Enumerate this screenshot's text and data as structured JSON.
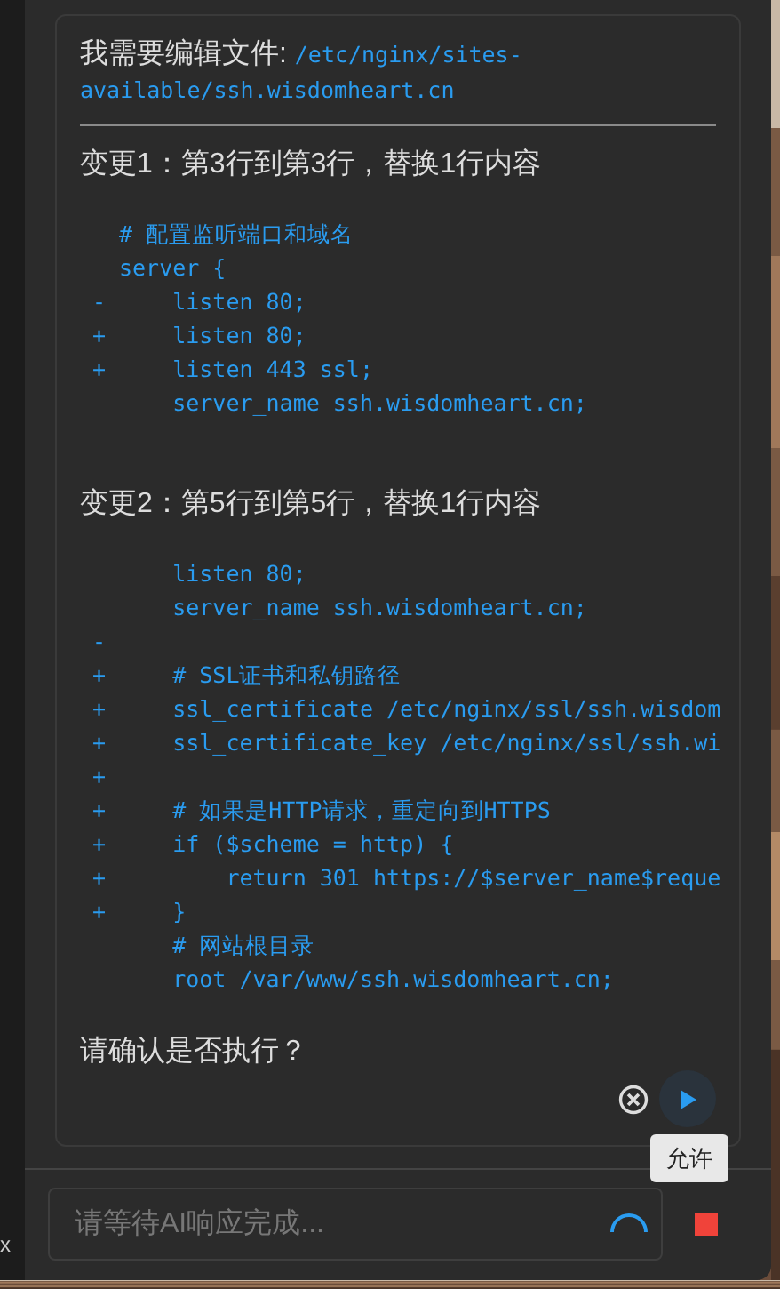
{
  "message": {
    "intro": "我需要编辑文件:",
    "path": "/etc/nginx/sites-available/ssh.wisdomheart.cn",
    "changes": [
      {
        "title": "变更1：第3行到第3行，替换1行内容",
        "lines": [
          {
            "text": "# 配置监听端口和域名"
          },
          {
            "text": "server {"
          },
          {
            "marker": "-",
            "text": "    listen 80;"
          },
          {
            "marker": "+",
            "text": "    listen 80;"
          },
          {
            "marker": "+",
            "text": "    listen 443 ssl;"
          },
          {
            "text": "    server_name ssh.wisdomheart.cn;"
          }
        ]
      },
      {
        "title": "变更2：第5行到第5行，替换1行内容",
        "lines": [
          {
            "text": "    listen 80;"
          },
          {
            "text": "    server_name ssh.wisdomheart.cn;"
          },
          {
            "marker": "-"
          },
          {
            "marker": "+",
            "text": "    # SSL证书和私钥路径"
          },
          {
            "marker": "+",
            "text": "    ssl_certificate /etc/nginx/ssl/ssh.wisdom"
          },
          {
            "marker": "+",
            "text": "    ssl_certificate_key /etc/nginx/ssl/ssh.wi"
          },
          {
            "marker": "+"
          },
          {
            "marker": "+",
            "text": "    # 如果是HTTP请求，重定向到HTTPS"
          },
          {
            "marker": "+",
            "text": "    if ($scheme = http) {"
          },
          {
            "marker": "+",
            "text": "        return 301 https://$server_name$reque"
          },
          {
            "marker": "+",
            "text": "    }"
          },
          {
            "text": "    # 网站根目录"
          },
          {
            "text": "    root /var/www/ssh.wisdomheart.cn;"
          }
        ]
      }
    ],
    "question": "请确认是否执行？"
  },
  "tooltip": "允许",
  "input": {
    "placeholder": "请等待AI响应完成..."
  },
  "side_text": "x"
}
